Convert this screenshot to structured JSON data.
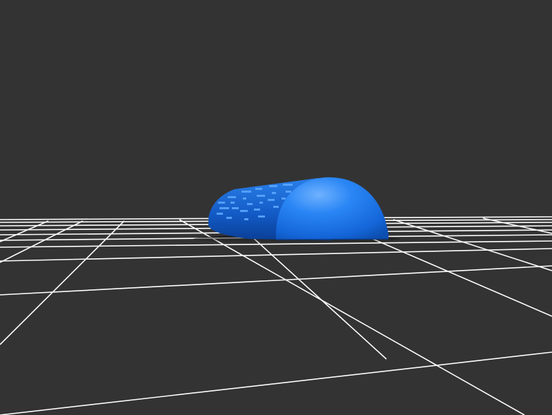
{
  "viewport": {
    "background_color": "#333333",
    "grid_color": "#ffffff",
    "model_color": "#1e78f0",
    "model_shape": "half-cylinder with embossed braille dot pattern on curved surface",
    "grid": true
  }
}
